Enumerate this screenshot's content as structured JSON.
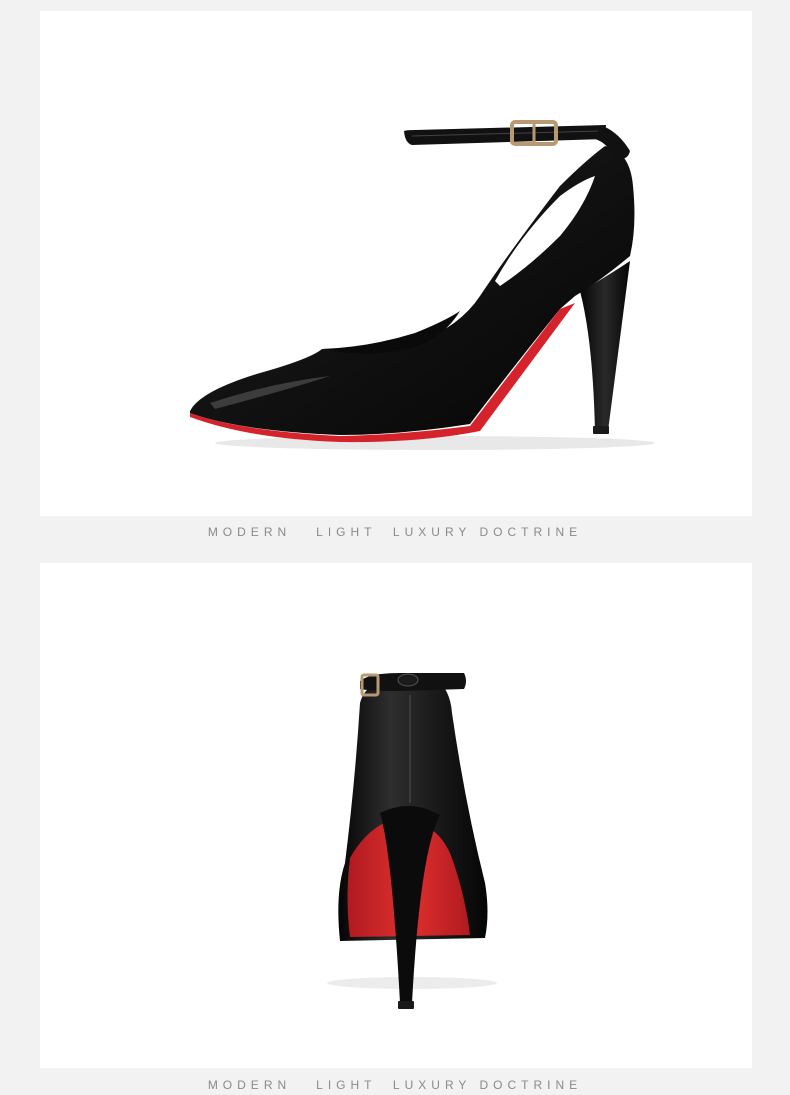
{
  "product": {
    "description": "black pointed-toe stiletto pump with ankle strap and red sole",
    "colors": {
      "leather": "#111111",
      "sole": "#d4232a",
      "buckle": "#b89a72",
      "background": "#f2f2f2",
      "panel": "#ffffff",
      "caption_text": "#8a8a8a"
    }
  },
  "sections": [
    {
      "view": "side view",
      "caption": "MODERN   LIGHT  LUXURY DOCTRINE"
    },
    {
      "view": "back view",
      "caption": "MODERN   LIGHT  LUXURY DOCTRINE"
    }
  ]
}
